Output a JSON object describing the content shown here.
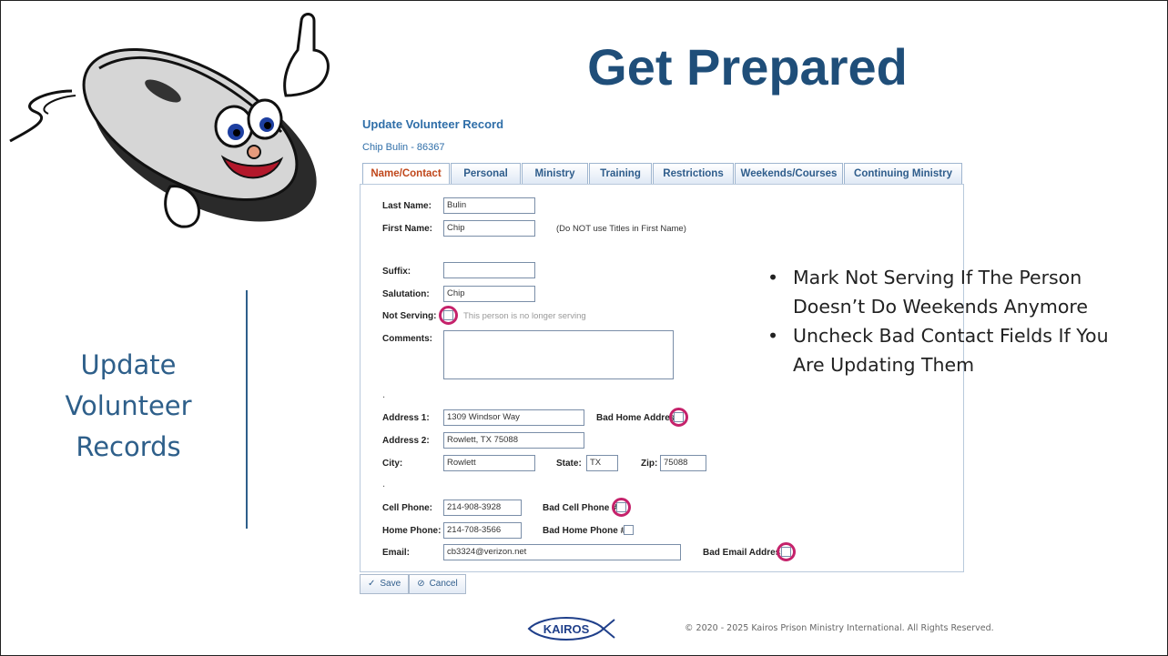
{
  "slide": {
    "title": "Get Prepared",
    "left_title": [
      "Update",
      "Volunteer",
      "Records"
    ],
    "bullets": [
      "Mark Not Serving If The Person Doesn’t Do Weekends Anymore",
      "Uncheck Bad Contact Fields If You Are Updating Them"
    ],
    "logo_text": "KAIROS",
    "copyright": "© 2020 - 2025 Kairos Prison Ministry International. All Rights Reserved."
  },
  "form": {
    "title": "Update Volunteer Record",
    "subtitle": "Chip Bulin - 86367",
    "tabs": [
      "Name/Contact",
      "Personal",
      "Ministry",
      "Training",
      "Restrictions",
      "Weekends/Courses",
      "Continuing Ministry"
    ],
    "active_tab": "Name/Contact",
    "labels": {
      "last_name": "Last Name:",
      "first_name": "First Name:",
      "suffix": "Suffix:",
      "salutation": "Salutation:",
      "not_serving": "Not Serving:",
      "comments": "Comments:",
      "address1": "Address 1:",
      "address2": "Address 2:",
      "city": "City:",
      "state": "State:",
      "zip": "Zip:",
      "cell_phone": "Cell Phone:",
      "home_phone": "Home Phone:",
      "email": "Email:",
      "bad_home_address": "Bad Home Address:",
      "bad_cell_phone": "Bad Cell Phone #:",
      "bad_home_phone": "Bad Home Phone #:",
      "bad_email": "Bad Email Address:"
    },
    "values": {
      "last_name": "Bulin",
      "first_name": "Chip",
      "suffix": "",
      "salutation": "Chip",
      "comments": "",
      "address1": "1309 Windsor Way",
      "address2": "Rowlett, TX 75088",
      "city": "Rowlett",
      "state": "TX",
      "zip": "75088",
      "cell_phone": "214-908-3928",
      "home_phone": "214-708-3566",
      "email": "cb3324@verizon.net"
    },
    "first_name_note": "(Do NOT use Titles in First Name)",
    "not_serving_note": "This person is no longer serving",
    "checkboxes": {
      "not_serving": false,
      "bad_home_address": false,
      "bad_cell_phone": false,
      "bad_home_phone": false,
      "bad_email": false
    },
    "buttons": {
      "save": "Save",
      "cancel": "Cancel",
      "save_icon": "✓",
      "cancel_icon": "⊘"
    }
  },
  "colors": {
    "title": "#1f4e79",
    "highlight_ring": "#c5226b",
    "active_tab": "#c0471b",
    "form_blue": "#2f6ea8"
  }
}
